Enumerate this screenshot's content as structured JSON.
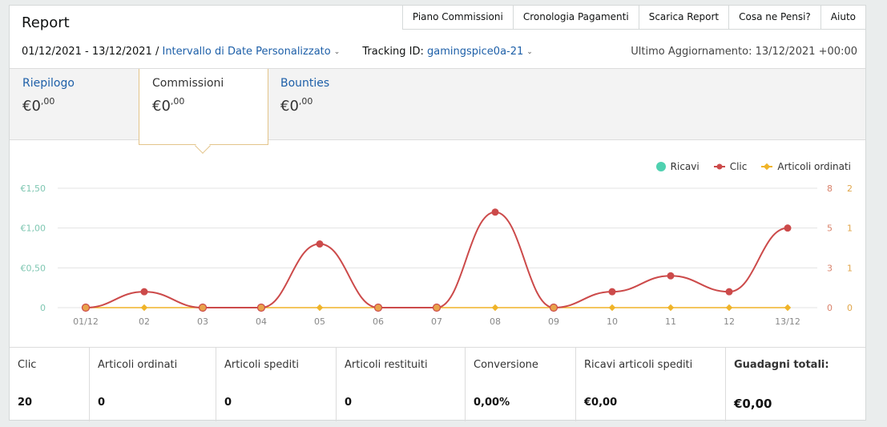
{
  "header": {
    "title": "Report",
    "nav": [
      "Piano Commissioni",
      "Cronologia Pagamenti",
      "Scarica Report",
      "Cosa ne Pensi?",
      "Aiuto"
    ]
  },
  "daterange": {
    "dates": "01/12/2021 - 13/12/2021",
    "separator": "/",
    "range_label": "Intervallo di Date Personalizzato",
    "tracking_label": "Tracking ID:",
    "tracking_id": "gamingspice0a-21",
    "last_update": "Ultimo Aggiornamento: 13/12/2021 +00:00"
  },
  "tabs": [
    {
      "label": "Riepilogo",
      "euro": "€",
      "whole": "0",
      "cents": ",00"
    },
    {
      "label": "Commissioni",
      "euro": "€",
      "whole": "0",
      "cents": ",00"
    },
    {
      "label": "Bounties",
      "euro": "€",
      "whole": "0",
      "cents": ",00"
    }
  ],
  "legend": [
    {
      "label": "Ricavi",
      "color": "#4fd1b0"
    },
    {
      "label": "Clic",
      "color": "#cc4a4a"
    },
    {
      "label": "Articoli ordinati",
      "color": "#f0b429"
    }
  ],
  "chart_data": {
    "type": "line",
    "categories": [
      "01/12",
      "02",
      "03",
      "04",
      "05",
      "06",
      "07",
      "08",
      "09",
      "10",
      "11",
      "12",
      "13/12"
    ],
    "y_left_ticks": [
      "€1,50",
      "€1,00",
      "€0,50",
      "0"
    ],
    "y_right1_ticks": [
      "8",
      "5",
      "3",
      "0"
    ],
    "y_right2_ticks": [
      "2",
      "1",
      "1",
      "0"
    ],
    "series": [
      {
        "name": "Ricavi",
        "color": "#4fd1b0",
        "values": [
          0,
          0,
          0,
          0,
          0,
          0,
          0,
          0,
          0,
          0,
          0,
          0,
          0
        ]
      },
      {
        "name": "Clic",
        "color": "#cc4a4a",
        "values": [
          0,
          1,
          0,
          0,
          4,
          0,
          0,
          6,
          0,
          1,
          2,
          1,
          5
        ]
      },
      {
        "name": "Articoli ordinati",
        "color": "#f0b429",
        "values": [
          0,
          0,
          0,
          0,
          0,
          0,
          0,
          0,
          0,
          0,
          0,
          0,
          0
        ]
      }
    ]
  },
  "stats": [
    {
      "label": "Clic",
      "value": "20"
    },
    {
      "label": "Articoli ordinati",
      "value": "0"
    },
    {
      "label": "Articoli spediti",
      "value": "0"
    },
    {
      "label": "Articoli restituiti",
      "value": "0"
    },
    {
      "label": "Conversione",
      "value": "0,00%"
    },
    {
      "label": "Ricavi articoli spediti",
      "value": "€0,00"
    },
    {
      "label": "Guadagni totali:",
      "value": "€0,00"
    }
  ]
}
